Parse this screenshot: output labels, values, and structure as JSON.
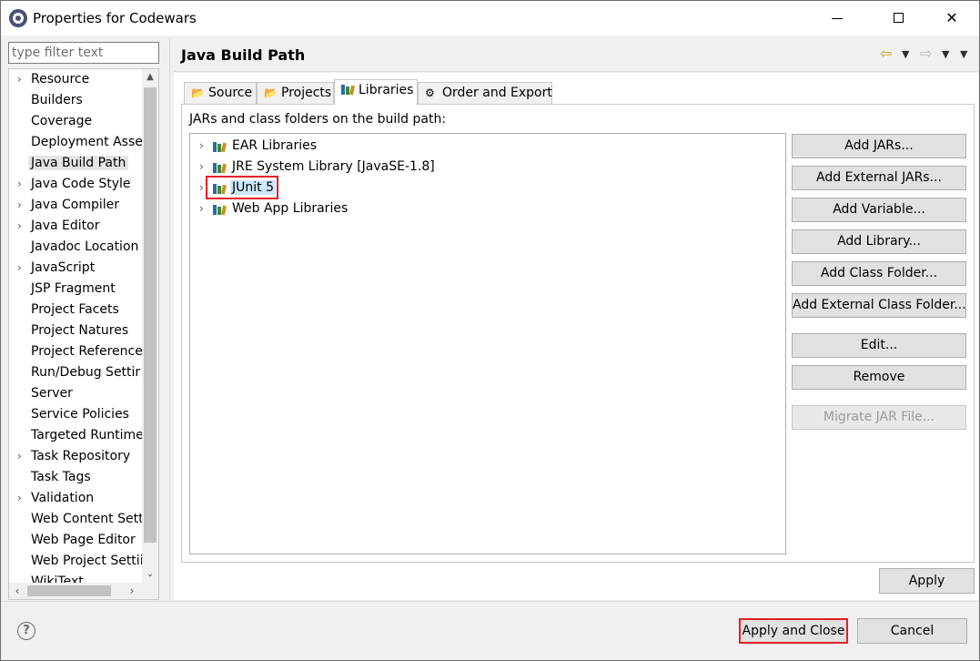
{
  "window": {
    "title": "Properties for Codewars",
    "minimize_label": "",
    "maximize_label": "",
    "close_label": "✕"
  },
  "filter": {
    "placeholder": "type filter text",
    "value": ""
  },
  "nav": {
    "items": [
      {
        "label": "Resource",
        "expandable": true
      },
      {
        "label": "Builders",
        "expandable": false
      },
      {
        "label": "Coverage",
        "expandable": false
      },
      {
        "label": "Deployment Asse",
        "expandable": false
      },
      {
        "label": "Java Build Path",
        "expandable": false,
        "selected": true
      },
      {
        "label": "Java Code Style",
        "expandable": true
      },
      {
        "label": "Java Compiler",
        "expandable": true
      },
      {
        "label": "Java Editor",
        "expandable": true
      },
      {
        "label": "Javadoc Location",
        "expandable": false
      },
      {
        "label": "JavaScript",
        "expandable": true
      },
      {
        "label": "JSP Fragment",
        "expandable": false
      },
      {
        "label": "Project Facets",
        "expandable": false
      },
      {
        "label": "Project Natures",
        "expandable": false
      },
      {
        "label": "Project Reference",
        "expandable": false
      },
      {
        "label": "Run/Debug Settir",
        "expandable": false
      },
      {
        "label": "Server",
        "expandable": false
      },
      {
        "label": "Service Policies",
        "expandable": false
      },
      {
        "label": "Targeted Runtime",
        "expandable": false
      },
      {
        "label": "Task Repository",
        "expandable": true
      },
      {
        "label": "Task Tags",
        "expandable": false
      },
      {
        "label": "Validation",
        "expandable": true
      },
      {
        "label": "Web Content Sett",
        "expandable": false
      },
      {
        "label": "Web Page Editor",
        "expandable": false
      },
      {
        "label": "Web Project Settii",
        "expandable": false
      },
      {
        "label": "WikiText",
        "expandable": false
      }
    ]
  },
  "page": {
    "title": "Java Build Path",
    "tabs": [
      {
        "label": "Source",
        "icon": "source-folder-icon"
      },
      {
        "label": "Projects",
        "icon": "projects-folder-icon"
      },
      {
        "label": "Libraries",
        "icon": "libraries-icon",
        "active": true
      },
      {
        "label": "Order and Export",
        "icon": "order-export-icon"
      }
    ],
    "build_path_label": "JARs and class folders on the build path:",
    "libraries": [
      {
        "label": "EAR Libraries"
      },
      {
        "label": "JRE System Library [JavaSE-1.8]"
      },
      {
        "label": "JUnit 5",
        "selected": true
      },
      {
        "label": "Web App Libraries"
      }
    ],
    "buttons": {
      "add_jars": "Add JARs...",
      "add_external_jars": "Add External JARs...",
      "add_variable": "Add Variable...",
      "add_library": "Add Library...",
      "add_class_folder": "Add Class Folder...",
      "add_external_class_folder": "Add External Class Folder...",
      "edit": "Edit...",
      "remove": "Remove",
      "migrate_jar": "Migrate JAR File..."
    },
    "apply": "Apply"
  },
  "footer": {
    "help": "?",
    "apply_and_close": "Apply and Close",
    "cancel": "Cancel"
  },
  "colors": {
    "highlight_border": "#e0202a",
    "selection_bg": "#cde8ff"
  }
}
